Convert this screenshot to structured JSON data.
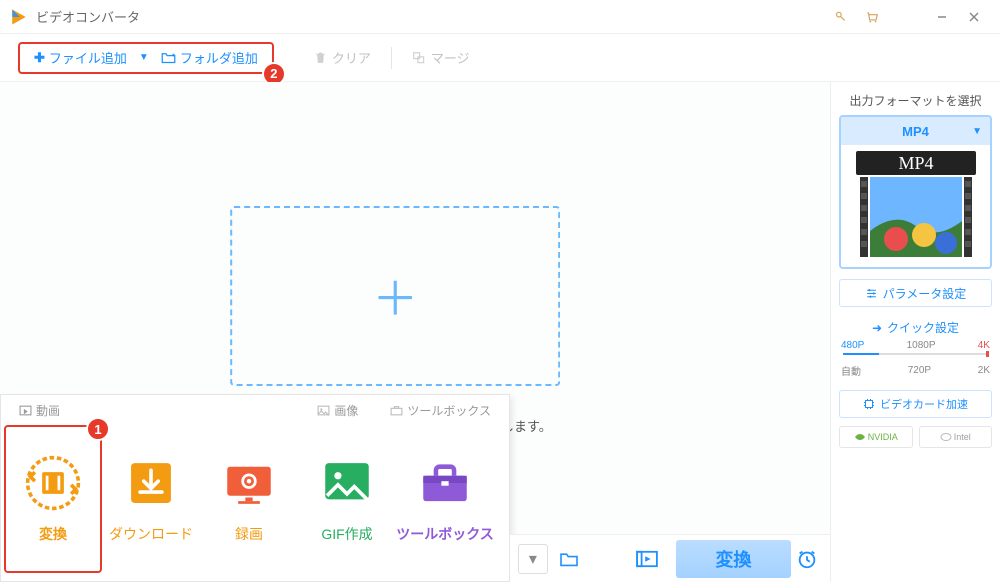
{
  "app_title": "ビデオコンバータ",
  "toolbar": {
    "add_file": "ファイル追加",
    "add_folder": "フォルダ追加",
    "clear": "クリア",
    "merge": "マージ"
  },
  "drop_hint": "こまでドラッグします。",
  "right_panel": {
    "title": "出力フォーマットを選択",
    "format_selected": "MP4",
    "thumb_badge": "MP4",
    "param_settings": "パラメータ設定",
    "quick_settings": "クイック設定",
    "res_row1": [
      "480P",
      "1080P",
      "4K"
    ],
    "res_row2": [
      "自動",
      "720P",
      "2K"
    ],
    "video_card": "ビデオカード加速",
    "brand1": "NVIDIA",
    "brand2": "Intel"
  },
  "bottom_tools": {
    "tabs": [
      "動画",
      "画像",
      "ツールボックス"
    ],
    "cards": [
      {
        "label": "変換",
        "active": true
      },
      {
        "label": "ダウンロード",
        "color": "orange"
      },
      {
        "label": "録画",
        "color": "orange"
      },
      {
        "label": "GIF作成",
        "color": "green"
      },
      {
        "label": "ツールボックス",
        "color": "purple"
      }
    ]
  },
  "bottom_bar": {
    "convert": "変換"
  },
  "annotations": {
    "badge1": "1",
    "badge2": "2"
  }
}
